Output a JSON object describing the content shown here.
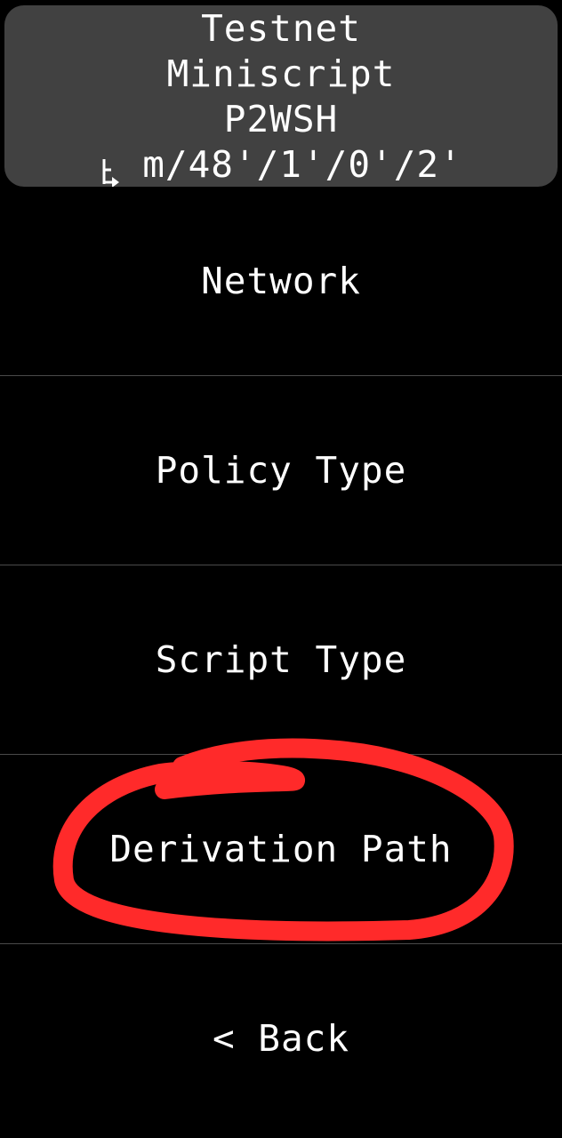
{
  "header": {
    "network": "Testnet",
    "policy_type": "Miniscript",
    "script_type": "P2WSH",
    "derivation_path": "m/48'/1'/0'/2'",
    "path_icon": "derivation-tree-icon"
  },
  "menu": {
    "items": [
      {
        "label": "Network"
      },
      {
        "label": "Policy Type"
      },
      {
        "label": "Script Type"
      },
      {
        "label": "Derivation Path"
      },
      {
        "label": "< Back"
      }
    ]
  },
  "annotation": {
    "color": "#ff2a2a",
    "encircles": "Derivation Path"
  },
  "colors": {
    "background": "#000000",
    "header_background": "#414141",
    "text": "#ffffff",
    "divider": "#4a4a4a"
  }
}
